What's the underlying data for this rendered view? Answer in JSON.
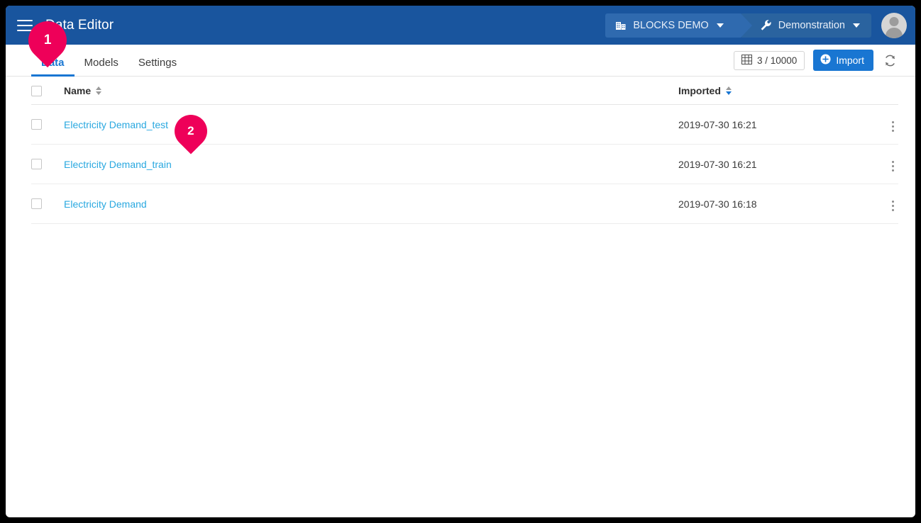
{
  "window": {
    "title": "Data Editor"
  },
  "header": {
    "menu_icon": "hamburger-icon",
    "title": "Data Editor",
    "breadcrumb": {
      "project": {
        "label": "BLOCKS DEMO",
        "icon": "building-icon",
        "caret": "chevron-down-icon"
      },
      "environment": {
        "label": "Demonstration",
        "icon": "wrench-icon",
        "caret": "chevron-down-icon"
      }
    },
    "avatar": "user-avatar-icon"
  },
  "tabs": [
    {
      "label": "Data",
      "active": true
    },
    {
      "label": "Models",
      "active": false
    },
    {
      "label": "Settings",
      "active": false
    }
  ],
  "toolbar": {
    "record_count": "3 / 10000",
    "record_count_icon": "table-grid-icon",
    "import_label": "Import",
    "import_icon": "plus-circle-icon",
    "refresh_icon": "refresh-icon"
  },
  "table": {
    "columns": {
      "select_all": "",
      "name": "Name",
      "imported": "Imported",
      "actions": ""
    },
    "sort": {
      "active_column": "imported",
      "direction": "desc"
    },
    "rows": [
      {
        "name": "Electricity Demand_test",
        "imported": "2019-07-30 16:21",
        "selected": false
      },
      {
        "name": "Electricity Demand_train",
        "imported": "2019-07-30 16:21",
        "selected": false
      },
      {
        "name": "Electricity Demand",
        "imported": "2019-07-30 16:18",
        "selected": false
      }
    ]
  },
  "annotations": [
    {
      "number": "1",
      "target": "tab-data"
    },
    {
      "number": "2",
      "target": "row-electricity-demand-test-name"
    }
  ],
  "colors": {
    "header_blue": "#19559E",
    "accent_blue": "#1976D2",
    "link_blue": "#29A8E0",
    "annotation_pink": "#EE0059"
  }
}
